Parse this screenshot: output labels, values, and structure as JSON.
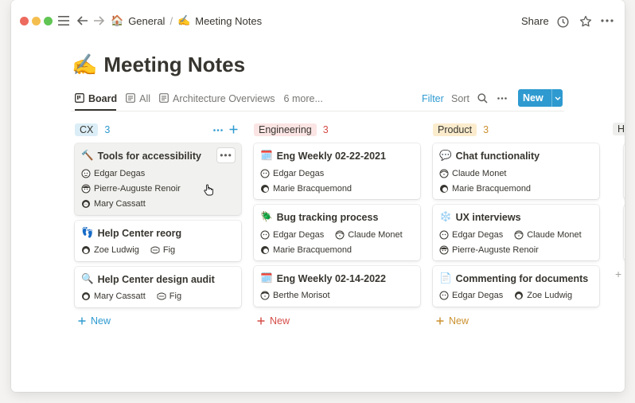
{
  "breadcrumb": {
    "workspace_icon": "house-emoji",
    "workspace": "General",
    "separator": "/",
    "page_icon": "writing-hand-emoji",
    "page": "Meeting Notes"
  },
  "topbar": {
    "share_label": "Share"
  },
  "page": {
    "title_icon": "✍️",
    "title": "Meeting Notes"
  },
  "views": {
    "tabs": [
      {
        "label": "Board",
        "icon": "board-icon"
      },
      {
        "label": "All",
        "icon": "table-icon"
      },
      {
        "label": "Architecture Overviews",
        "icon": "table-icon"
      }
    ],
    "more_label": "6 more...",
    "filter_label": "Filter",
    "sort_label": "Sort",
    "new_label": "New"
  },
  "colors": {
    "accent": "#2e9ad0"
  },
  "columns": [
    {
      "name": "CX",
      "count": "3",
      "pill_bg": "#dbeef7",
      "pill_fg": "#37352f",
      "count_color": "#2e9ad0",
      "add_label": "New",
      "add_color": "#2e9ad0",
      "cards": [
        {
          "emoji": "🔨",
          "title": "Tools for accessibility",
          "rows": [
            [
              "Edgar Degas"
            ],
            [
              "Pierre-Auguste Renoir"
            ],
            [
              "Mary Cassatt"
            ]
          ]
        },
        {
          "emoji": "👣",
          "title": "Help Center reorg",
          "rows": [
            [
              "Zoe Ludwig",
              "Fig"
            ]
          ]
        },
        {
          "emoji": "🔍",
          "title": "Help Center design audit",
          "rows": [
            [
              "Mary Cassatt",
              "Fig"
            ]
          ]
        }
      ]
    },
    {
      "name": "Engineering",
      "count": "3",
      "pill_bg": "#fbe4e4",
      "pill_fg": "#37352f",
      "count_color": "#d44c47",
      "add_label": "New",
      "add_color": "#d44c47",
      "cards": [
        {
          "emoji": "🗓️",
          "title": "Eng Weekly 02-22-2021",
          "rows": [
            [
              "Edgar Degas"
            ],
            [
              "Marie Bracquemond"
            ]
          ]
        },
        {
          "emoji": "🪲",
          "title": "Bug tracking process",
          "rows": [
            [
              "Edgar Degas",
              "Claude Monet"
            ],
            [
              "Marie Bracquemond"
            ]
          ]
        },
        {
          "emoji": "🗓️",
          "title": "Eng Weekly 02-14-2022",
          "rows": [
            [
              "Berthe Morisot"
            ]
          ]
        }
      ]
    },
    {
      "name": "Product",
      "count": "3",
      "pill_bg": "#fbeccd",
      "pill_fg": "#37352f",
      "count_color": "#cb912f",
      "add_label": "New",
      "add_color": "#cb912f",
      "cards": [
        {
          "emoji": "💬",
          "title": "Chat functionality",
          "rows": [
            [
              "Claude Monet"
            ],
            [
              "Marie Bracquemond"
            ]
          ]
        },
        {
          "emoji": "❄️",
          "title": "UX interviews",
          "rows": [
            [
              "Edgar Degas",
              "Claude Monet"
            ],
            [
              "Pierre-Auguste Renoir"
            ]
          ]
        },
        {
          "emoji": "📄",
          "title": "Commenting for documents",
          "rows": [
            [
              "Edgar Degas",
              "Zoe Ludwig"
            ]
          ]
        }
      ]
    }
  ],
  "peek_column": {
    "initial": "H",
    "row_label": "C"
  }
}
